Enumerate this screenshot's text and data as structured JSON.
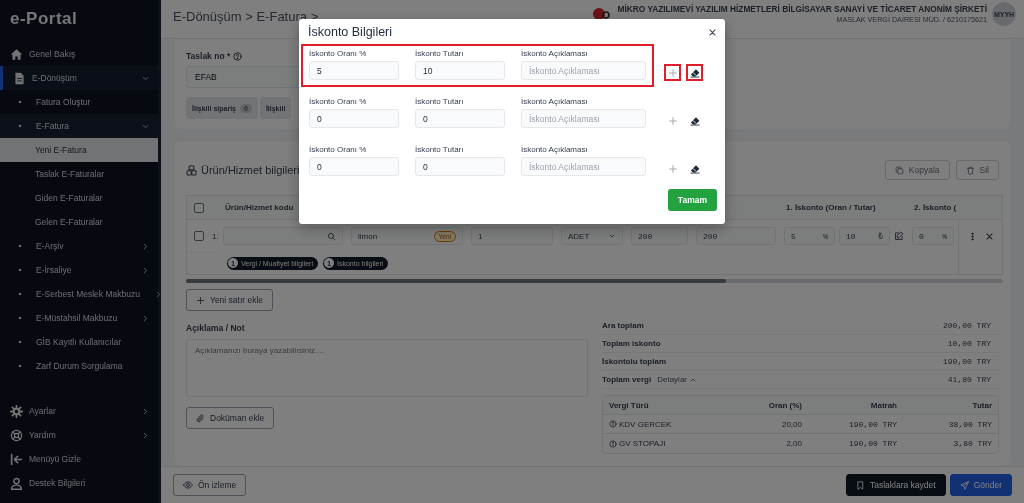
{
  "sidebar": {
    "logo": "e-Portal",
    "items": [
      {
        "label": "Genel Bakış",
        "selected": false
      },
      {
        "label": "E-Dönüşüm",
        "selected": false,
        "expanded": true,
        "children": [
          {
            "label": "Fatura Oluştur",
            "selected": false
          },
          {
            "label": "E-Fatura",
            "selected": false,
            "expanded": true,
            "children": [
              {
                "label": "Yeni E-Fatura",
                "selected": true
              },
              {
                "label": "Taslak E-Faturalar",
                "selected": false
              },
              {
                "label": "Giden E-Faturalar",
                "selected": false
              },
              {
                "label": "Gelen E-Faturalar",
                "selected": false
              }
            ]
          },
          {
            "label": "E-Arşiv",
            "selected": false,
            "expanded": false
          },
          {
            "label": "E-İrsaliye",
            "selected": false,
            "expanded": false
          },
          {
            "label": "E-Serbest Meslek Makbuzu",
            "selected": false,
            "expanded": false
          },
          {
            "label": "E-Müstahsil Makbuzu",
            "selected": false,
            "expanded": false
          },
          {
            "label": "GİB Kayıtlı Kullanıcılar",
            "selected": false
          },
          {
            "label": "Zarf Durum Sorgulama",
            "selected": false
          }
        ]
      }
    ],
    "footer_items": [
      {
        "label": "Ayarlar",
        "selected": false,
        "expanded": false
      },
      {
        "label": "Yardım",
        "selected": false,
        "expanded": false
      },
      {
        "label": "Menüyü Gizle",
        "selected": false
      },
      {
        "label": "Destek Bilgileri",
        "selected": false
      }
    ]
  },
  "header": {
    "breadcrumb": "E-Dönüşüm > E-Fatura >",
    "company": "MİKRO YAZILIMEVİ YAZILIM HİZMETLERİ BİLGİSAYAR SANAYİ VE TİCARET ANONİM ŞİRKETİ",
    "tax_office": "MASLAK VERGİ DAİRESİ MÜD. / 6210175621",
    "avatar": "MYYH"
  },
  "draft": {
    "label": "Taslak no *",
    "value": "EFAB",
    "related": [
      {
        "label": "İlişkili sipariş",
        "count": "0"
      },
      {
        "label": "İlişkili"
      }
    ]
  },
  "products": {
    "title": "Ürün/Hizmet bilgileri",
    "actions": [
      "Kopyala",
      "Sil"
    ],
    "select_all": {
      "checked": false
    },
    "columns": [
      {
        "kind": "code",
        "label": "Ürün/Hizmet kodu"
      },
      {
        "kind": "discount_1",
        "label": "1. İskonto (Oran / Tutar)"
      },
      {
        "kind": "discount_2",
        "label": "2. İskonto ("
      }
    ],
    "rows": [
      {
        "number": "1.",
        "checked": false,
        "name": "limon",
        "badge": "Yeni",
        "quantity": "1",
        "unit": "ADET",
        "price": "200",
        "total": "200",
        "discount_1": {
          "rate": "5",
          "rate_unit": "%",
          "amount": "10",
          "amount_unit": "₺"
        },
        "discount_2": {
          "rate": "0",
          "rate_unit": "%"
        },
        "tags": [
          {
            "count": "1",
            "label": "Vergi / Muafiyet bilgileri"
          },
          {
            "count": "1",
            "label": "İskonto bilgileri"
          }
        ]
      }
    ],
    "add_row": "Yeni satır ekle"
  },
  "notes": {
    "label": "Açıklama / Not",
    "placeholder": "Açıklamanızı buraya yazabilirsiniz....",
    "attach": "Doküman ekle"
  },
  "totals": [
    {
      "label": "Ara toplam",
      "value": "200,00 TRY"
    },
    {
      "label": "Toplam iskonto",
      "value": "10,00 TRY"
    },
    {
      "label": "İskontolu toplam",
      "value": "190,00 TRY"
    },
    {
      "label": "Toplam vergi",
      "link": "Detaylar",
      "expanded": true,
      "value": "41,80 TRY"
    }
  ],
  "tax_table": {
    "columns": [
      "Vergi Türü",
      "Oran (%)",
      "Matrah",
      "Tutar"
    ],
    "rows": [
      [
        "KDV GERCEK",
        "20,00",
        "190,00 TRY",
        "38,00 TRY"
      ],
      [
        "GV STOPAJI",
        "2,00",
        "190,00 TRY",
        "3,80 TRY"
      ]
    ]
  },
  "bottom_bar": {
    "preview": "Ön izleme",
    "save": "Taslaklara kaydet",
    "send": "Gönder"
  },
  "modal": {
    "title": "İskonto Bilgileri",
    "confirm": "Tamam",
    "rows": [
      {
        "highlighted": true,
        "actions_highlighted": true,
        "rate": {
          "label": "İskonto Oranı %",
          "value": "5"
        },
        "amount": {
          "label": "İskonto Tutarı",
          "value": "10"
        },
        "description": {
          "label": "İskonto Açıklaması",
          "placeholder": "İskonto Açıklaması"
        }
      },
      {
        "highlighted": false,
        "actions_highlighted": false,
        "rate": {
          "label": "İskonto Oranı %",
          "value": "0"
        },
        "amount": {
          "label": "İskonto Tutarı",
          "value": "0"
        },
        "description": {
          "label": "İskonto Açıklaması",
          "placeholder": "İskonto Açıklaması"
        }
      },
      {
        "highlighted": false,
        "actions_highlighted": false,
        "rate": {
          "label": "İskonto Oranı %",
          "value": "0"
        },
        "amount": {
          "label": "İskonto Tutarı",
          "value": "0"
        },
        "description": {
          "label": "İskonto Açıklaması",
          "placeholder": "İskonto Açıklaması"
        }
      }
    ]
  }
}
